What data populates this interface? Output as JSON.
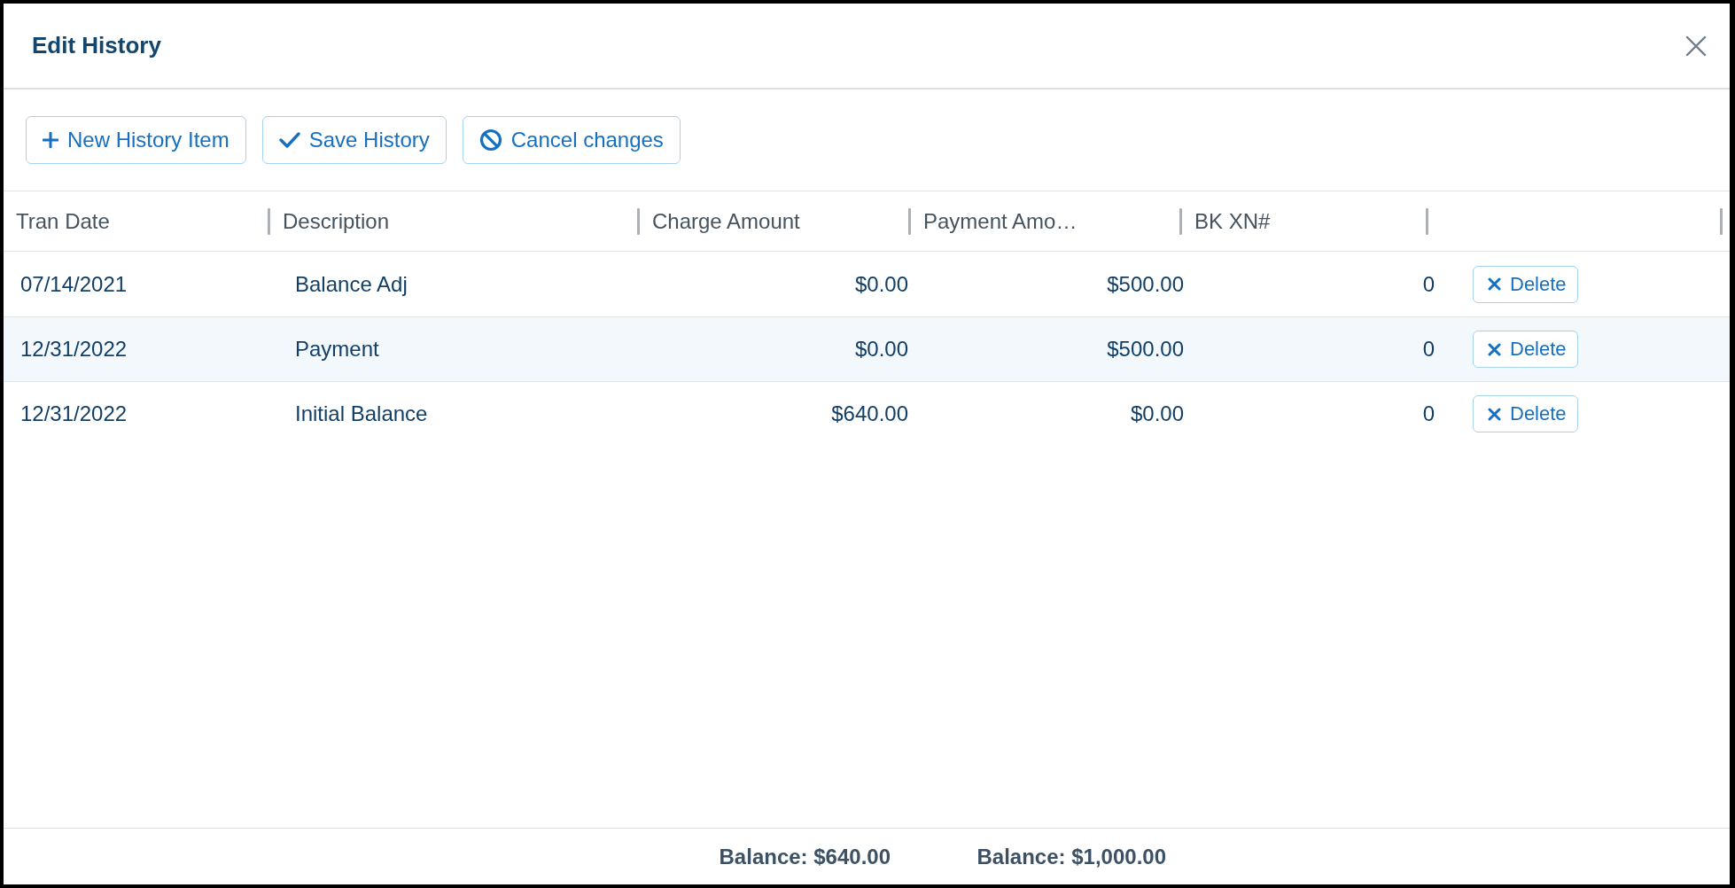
{
  "dialog": {
    "title": "Edit History"
  },
  "toolbar": [
    {
      "kind": "add",
      "label": "New History Item"
    },
    {
      "kind": "save",
      "label": "Save History"
    },
    {
      "kind": "cancel",
      "label": "Cancel changes"
    }
  ],
  "table": {
    "columns": [
      "Tran Date",
      "Description",
      "Charge Amount",
      "Payment Amo…",
      "BK XN#"
    ],
    "rows": [
      {
        "tran_date": "07/14/2021",
        "description": "Balance Adj",
        "charge_amount": "$0.00",
        "payment_amount": "$500.00",
        "bk_xn": "0",
        "action": "Delete"
      },
      {
        "tran_date": "12/31/2022",
        "description": "Payment",
        "charge_amount": "$0.00",
        "payment_amount": "$500.00",
        "bk_xn": "0",
        "action": "Delete"
      },
      {
        "tran_date": "12/31/2022",
        "description": "Initial Balance",
        "charge_amount": "$640.00",
        "payment_amount": "$0.00",
        "bk_xn": "0",
        "action": "Delete"
      }
    ]
  },
  "footer": {
    "charge_total": "Balance: $640.00",
    "payment_total": "Balance: $1,000.00"
  }
}
